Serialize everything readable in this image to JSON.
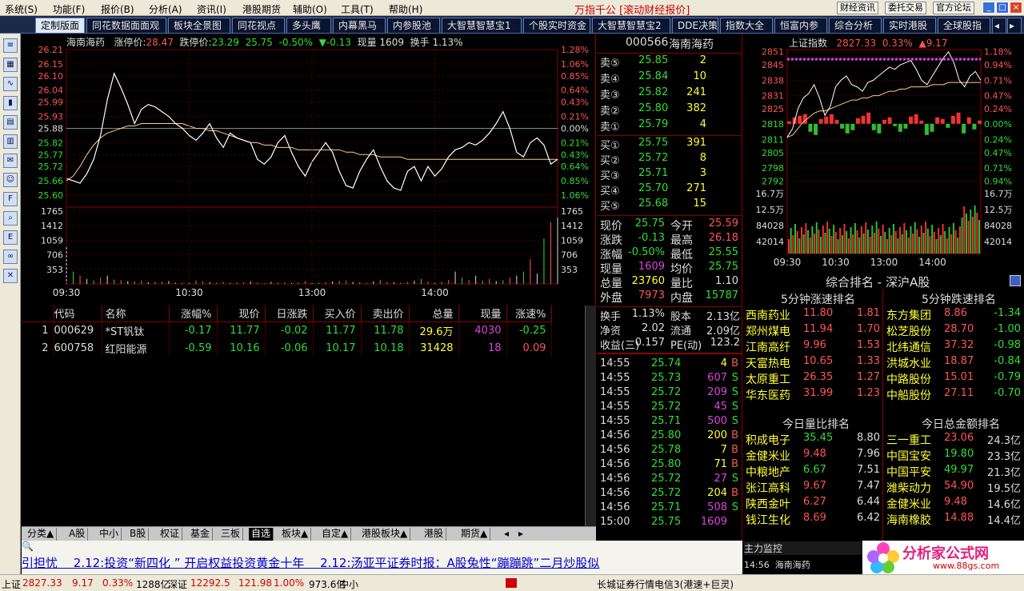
{
  "menu": {
    "items": [
      "系统(S)",
      "功能(F)",
      "报价(B)",
      "分析(A)",
      "资讯(I)",
      "港股期货",
      "辅助(O)",
      "工具(T)",
      "帮助(H)"
    ],
    "app_title": "万指千公 [滚动财经报价]",
    "top_buttons": [
      "财经资讯",
      "委托交易",
      "官方论坛"
    ]
  },
  "tabs": [
    "定制版面",
    "同花数据面面观",
    "板块全景图",
    "同花视点",
    "多头鹰",
    "内幕黑马",
    "内参股池",
    "大智慧智慧宝1",
    "个股实时资金",
    "大智慧智慧宝2",
    "DDE决策",
    "指数大全",
    "恒富内参",
    "综合分析",
    "实时港股",
    "全球股指"
  ],
  "chart_header": {
    "name": "海南海药",
    "limit_up_label": "涨停价:",
    "limit_up": "28.47",
    "limit_down_label": "跌停价:",
    "limit_down": "23.29",
    "price": "25.75",
    "pct": "-0.50%",
    "change": "▼-0.13",
    "vol_label": "现量",
    "vol": "1609",
    "turn_label": "换手",
    "turn": "1.13%"
  },
  "chart_data": [
    {
      "type": "line",
      "name": "minute-price",
      "y_ticks_left": [
        "26.21",
        "26.15",
        "26.10",
        "26.04",
        "25.99",
        "25.93",
        "25.88",
        "25.82",
        "25.77",
        "25.72",
        "25.66",
        "25.60"
      ],
      "y_ticks_right": [
        "1.28%",
        "1.06%",
        "0.85%",
        "0.64%",
        "0.43%",
        "0.21%",
        "0.00%",
        "0.21%",
        "0.43%",
        "0.64%",
        "0.85%",
        "1.06%"
      ],
      "prev_close": 25.88,
      "ylim": [
        25.59,
        26.21
      ],
      "x_ticks": [
        "09:30",
        "10:30",
        "13:00",
        "14:00"
      ],
      "price": [
        25.67,
        25.66,
        25.65,
        25.69,
        25.75,
        25.85,
        26.0,
        26.11,
        26.05,
        25.98,
        25.9,
        25.96,
        25.98,
        25.97,
        25.95,
        25.93,
        25.9,
        25.88,
        25.85,
        25.83,
        25.86,
        25.9,
        25.84,
        25.8,
        25.86,
        25.84,
        25.83,
        25.82,
        25.75,
        25.73,
        25.76,
        25.82,
        25.85,
        25.78,
        25.72,
        25.68,
        25.74,
        25.78,
        25.82,
        25.78,
        25.7,
        25.64,
        25.63,
        25.7,
        25.75,
        25.79,
        25.72,
        25.66,
        25.63,
        25.62,
        25.7,
        25.72,
        25.66,
        25.72,
        25.68,
        25.71,
        25.76,
        25.79,
        25.8,
        25.82,
        25.81,
        25.83,
        25.86,
        25.9,
        25.95,
        25.88,
        25.78,
        25.76,
        25.82,
        25.84,
        25.81,
        25.73,
        25.75
      ],
      "avg": [
        25.66,
        25.68,
        25.72,
        25.77,
        25.81,
        25.84,
        25.86,
        25.87,
        25.88,
        25.89,
        25.89,
        25.9,
        25.9,
        25.9,
        25.9,
        25.9,
        25.9,
        25.9,
        25.89,
        25.88,
        25.88,
        25.87,
        25.87,
        25.86,
        25.85,
        25.84,
        25.83,
        25.82,
        25.82,
        25.81,
        25.81,
        25.8,
        25.8,
        25.8,
        25.79,
        25.79,
        25.79,
        25.79,
        25.79,
        25.79,
        25.79,
        25.78,
        25.78,
        25.77,
        25.77,
        25.77,
        25.76,
        25.76,
        25.76,
        25.76,
        25.75,
        25.75,
        25.75,
        25.75,
        25.75,
        25.75,
        25.75,
        25.75,
        25.75,
        25.75,
        25.75,
        25.75,
        25.75,
        25.75,
        25.75,
        25.75,
        25.75,
        25.75,
        25.75,
        25.75,
        25.75,
        25.75,
        25.75
      ]
    },
    {
      "type": "bar",
      "name": "minute-volume",
      "y_ticks": [
        "1765",
        "1412",
        "1059",
        "706",
        "353"
      ],
      "ylim": [
        0,
        1765
      ],
      "values": [
        900,
        300,
        200,
        120,
        80,
        150,
        200,
        100,
        90,
        70,
        60,
        80,
        40,
        50,
        60,
        70,
        40,
        30,
        50,
        80,
        60,
        40,
        30,
        50,
        20,
        30,
        40,
        60,
        30,
        20,
        50,
        30,
        40,
        20,
        30,
        70,
        50,
        30,
        40,
        60,
        70,
        80,
        50,
        40,
        30,
        60,
        90,
        50,
        40,
        30,
        50,
        80,
        120,
        60,
        40,
        50,
        90,
        300,
        150,
        100,
        200,
        80,
        120,
        70,
        90,
        150,
        200,
        300,
        600,
        250,
        1100,
        1500,
        1609
      ]
    },
    {
      "type": "line",
      "name": "index-minute",
      "y_ticks_left": [
        "2851",
        "2845",
        "2838",
        "2831",
        "2825",
        "2818",
        "2811",
        "2805",
        "2798",
        "2792"
      ],
      "y_ticks_right": [
        "1.18%",
        "0.94%",
        "0.71%",
        "0.47%",
        "0.24%",
        "0.00%",
        "0.24%",
        "0.47%",
        "0.71%",
        "0.94%"
      ],
      "prev_close": 2818.16,
      "ylim": [
        2790,
        2852
      ],
      "x_ticks": [
        "09:30",
        "10:30",
        "13:00",
        "14:00"
      ],
      "vol_ticks": [
        "16.7万",
        "12.5万",
        "84028",
        "42014"
      ],
      "price": [
        2812,
        2816,
        2825,
        2830,
        2832,
        2836,
        2830,
        2822,
        2826,
        2835,
        2838,
        2840,
        2836,
        2835,
        2833,
        2837,
        2838,
        2840,
        2842,
        2844,
        2843,
        2845,
        2846,
        2847,
        2843,
        2838,
        2836,
        2840,
        2844,
        2848,
        2851,
        2846,
        2838,
        2835,
        2840,
        2842,
        2838
      ],
      "avg": [
        2812,
        2813,
        2816,
        2819,
        2821,
        2823,
        2824,
        2824,
        2825,
        2826,
        2827,
        2828,
        2829,
        2829,
        2830,
        2830,
        2831,
        2831,
        2832,
        2833,
        2833,
        2834,
        2834,
        2835,
        2835,
        2835,
        2835,
        2836,
        2836,
        2836,
        2837,
        2837,
        2837,
        2837,
        2837,
        2837,
        2837
      ],
      "tick_bars": [
        3,
        8,
        10,
        12,
        -10,
        -14,
        6,
        9,
        12,
        5,
        -6,
        -12,
        -8,
        7,
        10,
        14,
        -8,
        -12,
        5,
        8,
        -3,
        -10,
        -6,
        9,
        12,
        4,
        -14,
        -10,
        8,
        6,
        -5,
        10,
        14,
        -12,
        8,
        -7,
        4
      ]
    }
  ],
  "header_index": {
    "name": "上证指数",
    "value": "2827.33",
    "pct": "0.33%",
    "change": "▲9.17"
  },
  "table": {
    "headers": [
      "",
      "代码",
      "名称",
      "涨幅%",
      "现价",
      "日涨跌",
      "买入价",
      "卖出价",
      "总量",
      "现量",
      "涨速%"
    ],
    "rows": [
      [
        "1",
        "000629",
        "*ST钒钛",
        "-0.17",
        "11.77",
        "-0.02",
        "11.77",
        "11.78",
        "29.6万",
        "4030",
        "-0.25"
      ],
      [
        "2",
        "600758",
        "红阳能源",
        "-0.59",
        "10.16",
        "-0.06",
        "10.17",
        "10.18",
        "31428",
        "18",
        "0.09"
      ]
    ]
  },
  "bottom_tabs": [
    "分类▲",
    "A股",
    "中小",
    "B股",
    "权证",
    "基金",
    "三板",
    "自选",
    "板块▲",
    "自定▲",
    "港股板块▲",
    "港股",
    "期货▲"
  ],
  "quote": {
    "code": "000566",
    "name": "海南海药",
    "asks": [
      [
        "卖⑤",
        "25.85",
        "2"
      ],
      [
        "卖④",
        "25.84",
        "10"
      ],
      [
        "卖③",
        "25.82",
        "241"
      ],
      [
        "卖②",
        "25.80",
        "382"
      ],
      [
        "卖①",
        "25.79",
        "4"
      ]
    ],
    "bids": [
      [
        "买①",
        "25.75",
        "391"
      ],
      [
        "买②",
        "25.72",
        "8"
      ],
      [
        "买③",
        "25.71",
        "3"
      ],
      [
        "买④",
        "25.70",
        "271"
      ],
      [
        "买⑤",
        "25.68",
        "15"
      ]
    ],
    "stats": [
      [
        "现价",
        "25.75",
        "今开",
        "25.59"
      ],
      [
        "涨跌",
        "-0.13",
        "最高",
        "26.18"
      ],
      [
        "涨幅",
        "-0.50%",
        "最低",
        "25.55"
      ],
      [
        "现量",
        "1609",
        "均价",
        "25.75"
      ],
      [
        "总量",
        "23760",
        "量比",
        "1.10"
      ],
      [
        "外盘",
        "7973",
        "内盘",
        "15787"
      ]
    ],
    "stats2": [
      [
        "换手",
        "1.13%",
        "股本",
        "2.13亿"
      ],
      [
        "净资",
        "2.02",
        "流通",
        "2.09亿"
      ],
      [
        "收益(三)",
        "0.157",
        "PE(动)",
        "123.2"
      ]
    ],
    "ticks": [
      [
        "14:55",
        "25.74",
        "4",
        "B"
      ],
      [
        "14:55",
        "25.73",
        "607",
        "S"
      ],
      [
        "14:55",
        "25.72",
        "209",
        "S"
      ],
      [
        "14:55",
        "25.72",
        "45",
        "S"
      ],
      [
        "14:55",
        "25.71",
        "500",
        "S"
      ],
      [
        "14:56",
        "25.80",
        "200",
        "B"
      ],
      [
        "14:56",
        "25.78",
        "7",
        "B"
      ],
      [
        "14:56",
        "25.80",
        "71",
        "B"
      ],
      [
        "14:56",
        "25.72",
        "27",
        "S"
      ],
      [
        "14:56",
        "25.72",
        "204",
        "B"
      ],
      [
        "14:56",
        "25.71",
        "508",
        "S"
      ],
      [
        "15:00",
        "25.75",
        "1609",
        ""
      ]
    ]
  },
  "ranking": {
    "title": "综合排名 - 深沪A股",
    "up_title": "5分钟涨速排名",
    "down_title": "5分钟跌速排名",
    "vr_title": "今日量比排名",
    "amt_title": "今日总金额排名",
    "up": [
      [
        "西南药业",
        "11.80",
        "1.81"
      ],
      [
        "郑州煤电",
        "11.94",
        "1.70"
      ],
      [
        "江南高纤",
        "9.96",
        "1.53"
      ],
      [
        "天富热电",
        "10.65",
        "1.33"
      ],
      [
        "太原重工",
        "26.35",
        "1.27"
      ],
      [
        "华东医药",
        "31.99",
        "1.23"
      ]
    ],
    "down": [
      [
        "东方集团",
        "8.86",
        "-1.34"
      ],
      [
        "松芝股份",
        "28.70",
        "-1.00"
      ],
      [
        "北纬通信",
        "37.32",
        "-0.98"
      ],
      [
        "洪城水业",
        "18.87",
        "-0.84"
      ],
      [
        "中路股份",
        "15.01",
        "-0.79"
      ],
      [
        "中船股份",
        "27.11",
        "-0.70"
      ]
    ],
    "vr": [
      [
        "积成电子",
        "35.45",
        "8.80"
      ],
      [
        "金健米业",
        "9.48",
        "7.96"
      ],
      [
        "中粮地产",
        "6.67",
        "7.51"
      ],
      [
        "张江高科",
        "9.67",
        "7.47"
      ],
      [
        "陕西金叶",
        "6.27",
        "6.44"
      ],
      [
        "钱江生化",
        "8.69",
        "6.42"
      ]
    ],
    "amt": [
      [
        "三一重工",
        "23.06",
        "24.3亿"
      ],
      [
        "中国宝安",
        "19.80",
        "23.3亿"
      ],
      [
        "中国平安",
        "49.97",
        "21.3亿"
      ],
      [
        "潍柴动力",
        "54.90",
        "19.5亿"
      ],
      [
        "金健米业",
        "9.48",
        "14.6亿"
      ],
      [
        "海南橡胶",
        "14.88",
        "14.4亿"
      ]
    ]
  },
  "news": {
    "text": "引担忧　 2.12:投资“新四化 ” 开启权益投资黄金十年　 2.12:汤亚平证券时报：A股兔性“蹦蹦跳”二月炒股似"
  },
  "monitor": {
    "title": "主力监控",
    "row": "14:56  海南海药",
    "logo": "分析家公式网",
    "logo_url": "www.88gs.com"
  },
  "status": {
    "sh_label": "上证",
    "sh": "2827.33",
    "sh_chg": "9.17",
    "sh_pct": "0.33%",
    "sh_amt": "1288亿",
    "sz_label": "深证",
    "sz": "12292.5",
    "sz_chg": "121.98",
    "sz_pct": "1.00%",
    "sz_amt": "973.6亿",
    "zx": "中小",
    "server": "长城证券行情电信3(港速+巨灵)"
  }
}
